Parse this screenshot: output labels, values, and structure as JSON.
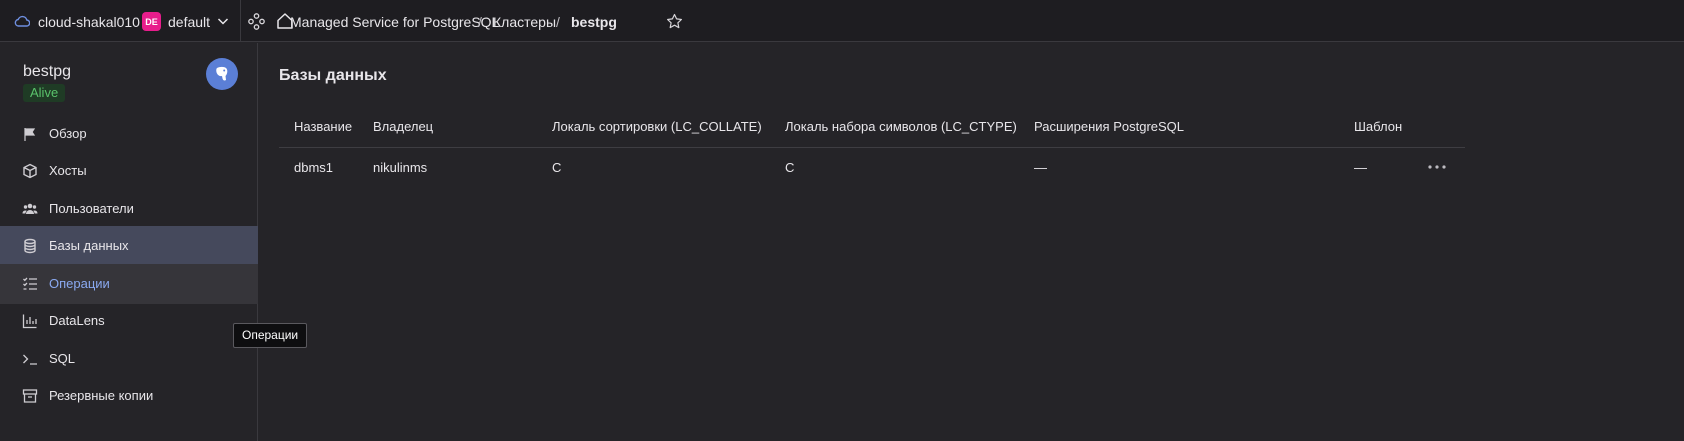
{
  "topbar": {
    "cloud_name": "cloud-shakal010",
    "folder_badge": "DE",
    "folder_name": "default",
    "breadcrumbs": [
      "Managed Service for PostgreSQL",
      "Кластеры",
      "bestpg"
    ],
    "separator": "/"
  },
  "sidebar": {
    "cluster_name": "bestpg",
    "status": "Alive",
    "items": [
      {
        "label": "Обзор",
        "icon": "flag-icon"
      },
      {
        "label": "Хосты",
        "icon": "cube-icon"
      },
      {
        "label": "Пользователи",
        "icon": "users-icon"
      },
      {
        "label": "Базы данных",
        "icon": "database-icon",
        "active": true
      },
      {
        "label": "Операции",
        "icon": "checklist-icon",
        "hover": true
      },
      {
        "label": "DataLens",
        "icon": "bar-chart-icon"
      },
      {
        "label": "SQL",
        "icon": "terminal-icon"
      },
      {
        "label": "Резервные копии",
        "icon": "archive-icon"
      }
    ]
  },
  "tooltip": "Операции",
  "main": {
    "title": "Базы данных",
    "columns": [
      "Название",
      "Владелец",
      "Локаль сортировки (LC_COLLATE)",
      "Локаль набора символов (LC_CTYPE)",
      "Расширения PostgreSQL",
      "Шаблон"
    ],
    "rows": [
      [
        "dbms1",
        "nikulinms",
        "C",
        "C",
        "—",
        "—"
      ]
    ]
  },
  "colors": {
    "accent_folder": "#e81d8c",
    "active_nav": "#45495c",
    "status_alive": "#5ac26b",
    "link_hover": "#8aa9f0"
  }
}
